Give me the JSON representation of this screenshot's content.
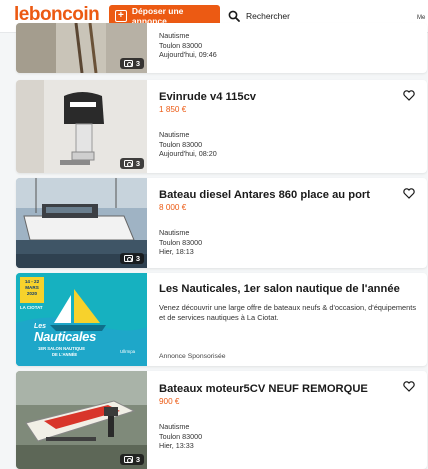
{
  "header": {
    "logo": "leboncoin",
    "post_button": "Déposer une annonce",
    "search_label": "Rechercher",
    "right_label": "Me"
  },
  "listings": [
    {
      "title": "",
      "price": "",
      "category": "Nautisme",
      "location": "Toulon 83000",
      "date": "Aujourd'hui, 09:46",
      "photo_count": "3",
      "image": "boat-oars"
    },
    {
      "title": "Evinrude v4 115cv",
      "price": "1 850 €",
      "category": "Nautisme",
      "location": "Toulon 83000",
      "date": "Aujourd'hui, 08:20",
      "photo_count": "3",
      "image": "outboard-motor"
    },
    {
      "title": "Bateau diesel Antares 860 place au port",
      "price": "8 000 €",
      "category": "Nautisme",
      "location": "Toulon 83000",
      "date": "Hier, 18:13",
      "photo_count": "3",
      "image": "diesel-boat-harbour"
    }
  ],
  "sponsored": {
    "title": "Les Nauticales, 1er salon nautique de l'année",
    "description": "Venez découvrir une large offre de bateaux neufs & d'occasion, d'équipements et de services nautiques à La Ciotat.",
    "label": "Annonce Sponsorisée",
    "banner": {
      "dates_line1": "14 - 22",
      "dates_line2": "MARS",
      "dates_line3": "2020",
      "place": "LA CIOTAT",
      "brand_top": "Les",
      "brand": "Nauticales",
      "tagline1": "1ER SALON NAUTIQUE",
      "tagline2": "DE L'ANNÉE",
      "sponsor": "Ullrmpa"
    }
  },
  "last_listing": {
    "title": "Bateaux moteur5CV NEUF REMORQUE",
    "price": "900 €",
    "category": "Nautisme",
    "location": "Toulon 83000",
    "date": "Hier, 13:33",
    "photo_count": "3",
    "image": "small-boat-trailer"
  },
  "colors": {
    "brand": "#ec5a13",
    "background": "#f4f6f7",
    "banner": "#16b1c0"
  }
}
